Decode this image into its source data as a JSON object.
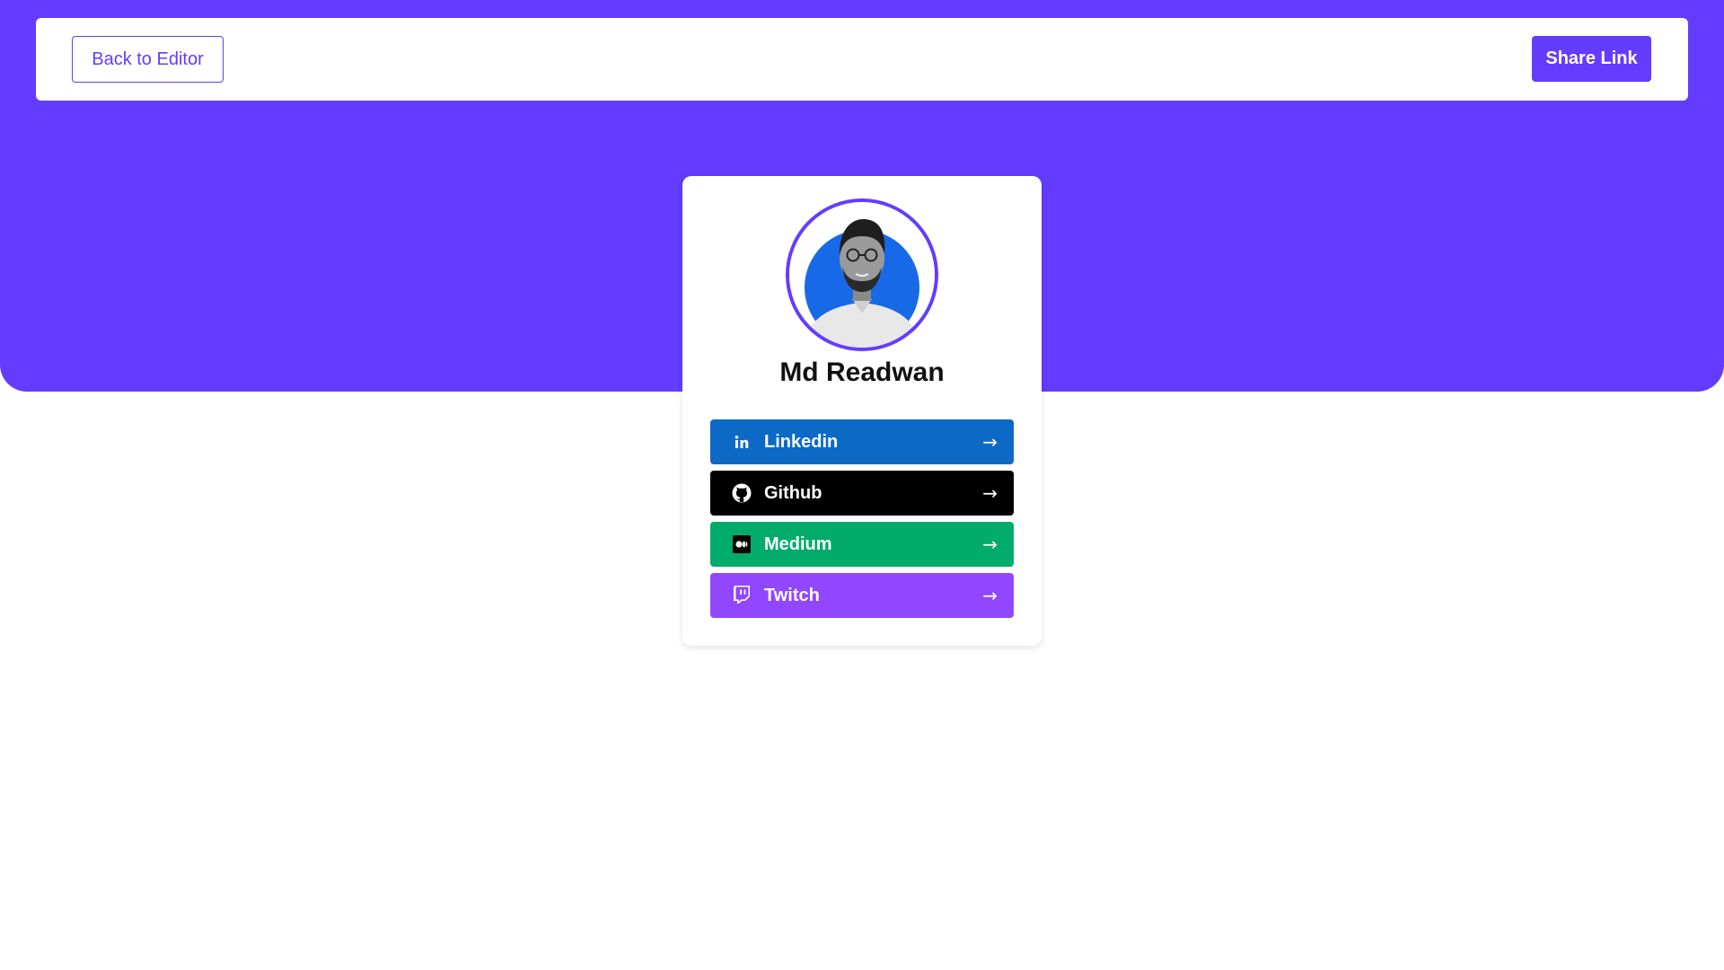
{
  "colors": {
    "brand": "#633cff",
    "linkedin": "#0c69c6",
    "github": "#000000",
    "medium": "#00ab6c",
    "twitch": "#9146ff"
  },
  "nav": {
    "back_label": "Back to Editor",
    "share_label": "Share Link"
  },
  "profile": {
    "name": "Md Readwan",
    "avatar_icon": "profile-photo"
  },
  "links": [
    {
      "label": "Linkedin",
      "icon": "linkedin-icon",
      "arrow": "→",
      "color": "#0c69c6"
    },
    {
      "label": "Github",
      "icon": "github-icon",
      "arrow": "→",
      "color": "#000000"
    },
    {
      "label": "Medium",
      "icon": "medium-icon",
      "arrow": "→",
      "color": "#00ab6c"
    },
    {
      "label": "Twitch",
      "icon": "twitch-icon",
      "arrow": "→",
      "color": "#9146ff"
    }
  ]
}
